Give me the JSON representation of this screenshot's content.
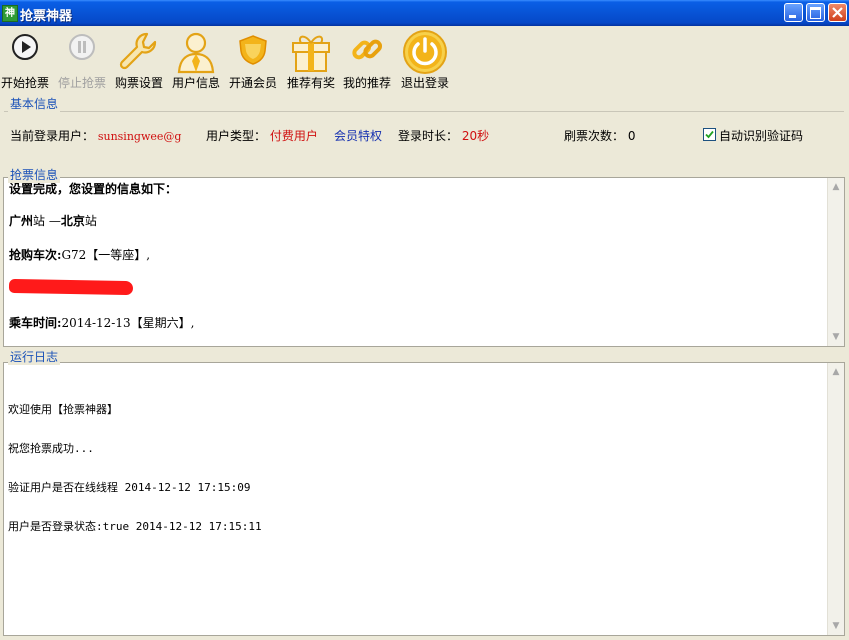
{
  "window": {
    "icon_char": "神",
    "title": "抢票神器"
  },
  "toolbar": {
    "items": [
      {
        "label": "开始抢票",
        "icon": "play-icon"
      },
      {
        "label": "停止抢票",
        "icon": "pause-icon",
        "disabled": true
      },
      {
        "label": "购票设置",
        "icon": "wrench-icon"
      },
      {
        "label": "用户信息",
        "icon": "user-icon"
      },
      {
        "label": "开通会员",
        "icon": "shield-icon"
      },
      {
        "label": "推荐有奖",
        "icon": "gift-icon"
      },
      {
        "label": "我的推荐",
        "icon": "link-icon"
      },
      {
        "label": "退出登录",
        "icon": "power-icon"
      }
    ]
  },
  "basic": {
    "title": "基本信息",
    "user_label": "当前登录用户：",
    "user_value": "sunsingwee@g",
    "type_label": "用户类型：",
    "type_value": "付费用户",
    "member_link": "会员特权",
    "time_label": "登录时长：",
    "time_value": "20秒",
    "refresh_label": "刷票次数：",
    "refresh_value": "0",
    "auto_captcha": "自动识别验证码",
    "auto_captcha_checked": true
  },
  "ticket": {
    "title": "抢票信息",
    "line1": "设置完成，您设置的信息如下：",
    "route_from": "广州",
    "route_mid": "站 —",
    "route_to": "北京",
    "route_end": "站",
    "train_label": "抢购车次:",
    "train_value": "G72【一等座】,",
    "date_label": "乘车时间:",
    "date_value": "2014-12-13【星期六】,"
  },
  "log": {
    "title": "运行日志",
    "lines": [
      "欢迎使用【抢票神器】",
      "祝您抢票成功...",
      "验证用户是否在线线程 2014-12-12 17:15:09",
      "用户是否登录状态:true 2014-12-12 17:15:11"
    ]
  },
  "colors": {
    "accent_red": "#d01010",
    "link_blue": "#1530b0",
    "group_title": "#1b52b8",
    "icon_gold": "#f3b41a"
  }
}
